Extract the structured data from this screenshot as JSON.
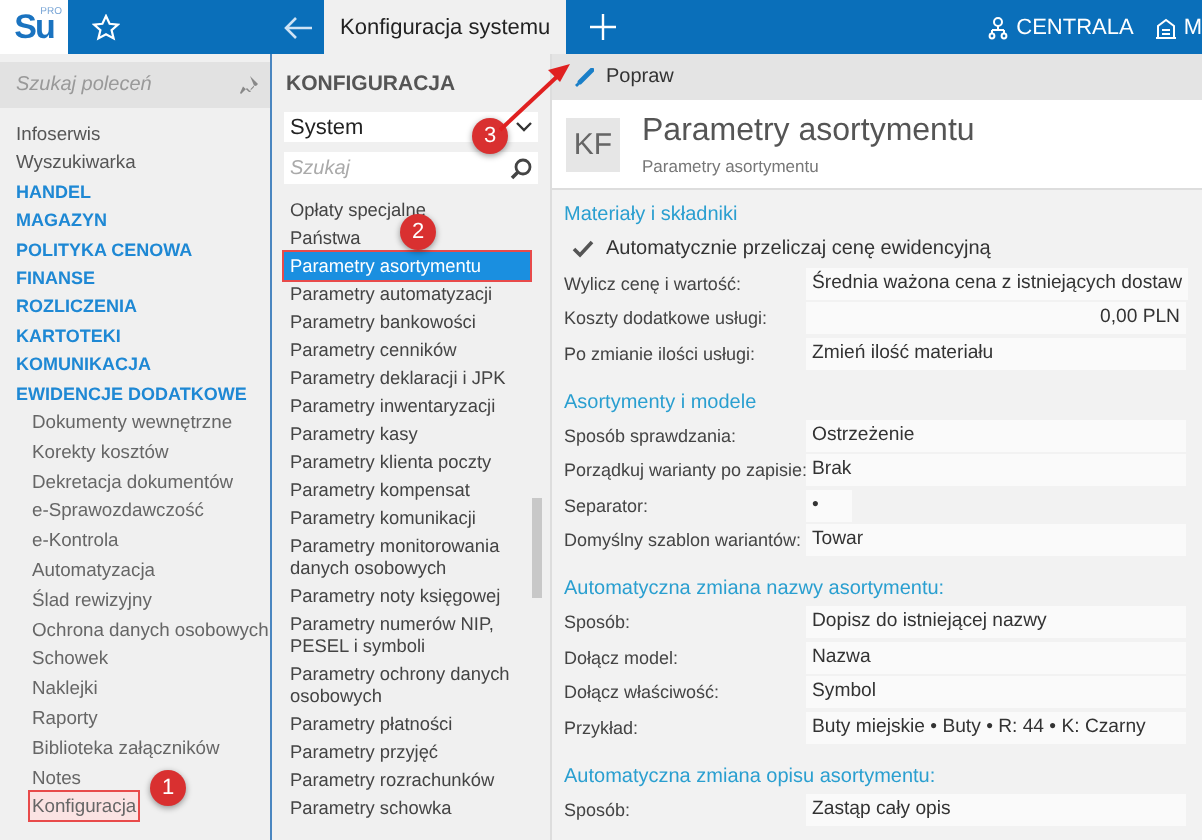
{
  "top_bar": {
    "logo": "Su",
    "logo_badge": "PRO",
    "tab": {
      "label": "Konfiguracja systemu",
      "selected": true
    },
    "location": "CENTRALA",
    "store": "M"
  },
  "sidebar": {
    "search_placeholder": "Szukaj poleceń",
    "items": [
      {
        "label": "Infoserwis",
        "kind": "link"
      },
      {
        "label": "Wyszukiwarka",
        "kind": "link"
      },
      {
        "label": "HANDEL",
        "kind": "category"
      },
      {
        "label": "MAGAZYN",
        "kind": "category"
      },
      {
        "label": "POLITYKA CENOWA",
        "kind": "category"
      },
      {
        "label": "FINANSE",
        "kind": "category"
      },
      {
        "label": "ROZLICZENIA",
        "kind": "category"
      },
      {
        "label": "KARTOTEKI",
        "kind": "category"
      },
      {
        "label": "KOMUNIKACJA",
        "kind": "category"
      },
      {
        "label": "EWIDENCJE DODATKOWE",
        "kind": "category",
        "children": [
          {
            "label": "Dokumenty wewnętrzne",
            "highlighted": false
          },
          {
            "label": "Korekty kosztów",
            "highlighted": false
          },
          {
            "label": "Dekretacja dokumentów",
            "highlighted": false
          },
          {
            "label": "e-Sprawozdawczość",
            "highlighted": false
          },
          {
            "label": "e-Kontrola",
            "highlighted": false
          },
          {
            "label": "Automatyzacja",
            "highlighted": false
          },
          {
            "label": "Ślad rewizyjny",
            "highlighted": false
          },
          {
            "label": "Ochrona danych osobowych",
            "highlighted": false
          },
          {
            "label": "Schowek",
            "highlighted": false
          },
          {
            "label": "Naklejki",
            "highlighted": false
          },
          {
            "label": "Raporty",
            "highlighted": false
          },
          {
            "label": "Biblioteka załączników",
            "highlighted": false
          },
          {
            "label": "Notes",
            "highlighted": false
          },
          {
            "label": "Konfiguracja",
            "highlighted": true
          }
        ]
      }
    ]
  },
  "middle": {
    "heading": "KONFIGURACJA",
    "module": "System",
    "search_placeholder": "Szukaj",
    "items": [
      {
        "label": "Opłaty specjalne",
        "selected": false
      },
      {
        "label": "Państwa",
        "selected": false
      },
      {
        "label": "Parametry asortymentu",
        "selected": true
      },
      {
        "label": "Parametry automatyzacji",
        "selected": false
      },
      {
        "label": "Parametry bankowości",
        "selected": false
      },
      {
        "label": "Parametry cenników",
        "selected": false
      },
      {
        "label": "Parametry deklaracji i JPK",
        "selected": false
      },
      {
        "label": "Parametry inwentaryzacji",
        "selected": false
      },
      {
        "label": "Parametry kasy",
        "selected": false
      },
      {
        "label": "Parametry klienta poczty",
        "selected": false
      },
      {
        "label": "Parametry kompensat",
        "selected": false
      },
      {
        "label": "Parametry komunikacji",
        "selected": false
      },
      {
        "label": "Parametry monitorowania danych osobowych",
        "selected": false
      },
      {
        "label": "Parametry noty księgowej",
        "selected": false
      },
      {
        "label": "Parametry numerów NIP, PESEL i symboli",
        "selected": false
      },
      {
        "label": "Parametry ochrony danych osobowych",
        "selected": false
      },
      {
        "label": "Parametry płatności",
        "selected": false
      },
      {
        "label": "Parametry przyjęć",
        "selected": false
      },
      {
        "label": "Parametry rozrachunków",
        "selected": false
      },
      {
        "label": "Parametry schowka",
        "selected": false
      }
    ]
  },
  "content": {
    "edit_button": "Popraw",
    "header": {
      "badge": "KF",
      "title": "Parametry asortymentu",
      "subtitle": "Parametry asortymentu"
    },
    "sections": [
      {
        "title": "Materiały i składniki",
        "rows": [
          {
            "kind": "checkbox",
            "label": "Automatycznie przeliczaj cenę ewidencyjną",
            "checked": true
          },
          {
            "kind": "text",
            "label": "Wylicz cenę i wartość:",
            "value": "Średnia ważona cena z istniejących dostaw"
          },
          {
            "kind": "amount",
            "label": "Koszty dodatkowe usługi:",
            "value": "0,00 PLN"
          },
          {
            "kind": "text",
            "label": "Po zmianie ilości usługi:",
            "value": "Zmień ilość materiału"
          }
        ]
      },
      {
        "title": "Asortymenty i modele",
        "rows": [
          {
            "kind": "text",
            "label": "Sposób sprawdzania:",
            "value": "Ostrzeżenie"
          },
          {
            "kind": "text",
            "label": "Porządkuj warianty po zapisie:",
            "value": "Brak"
          },
          {
            "kind": "short",
            "label": "Separator:",
            "value": "•"
          },
          {
            "kind": "text",
            "label": "Domyślny szablon wariantów:",
            "value": "Towar"
          }
        ]
      },
      {
        "title": "Automatyczna zmiana nazwy asortymentu:",
        "rows": [
          {
            "kind": "text",
            "label": "Sposób:",
            "value": "Dopisz do istniejącej nazwy"
          },
          {
            "kind": "text",
            "label": "Dołącz model:",
            "value": "Nazwa"
          },
          {
            "kind": "text",
            "label": "Dołącz właściwość:",
            "value": "Symbol"
          },
          {
            "kind": "text",
            "label": "Przykład:",
            "value": "Buty miejskie • Buty • R: 44 • K: Czarny"
          }
        ]
      },
      {
        "title": "Automatyczna zmiana opisu asortymentu:",
        "rows": [
          {
            "kind": "text",
            "label": "Sposób:",
            "value": "Zastąp cały opis"
          }
        ]
      }
    ]
  },
  "callouts": [
    "1",
    "2",
    "3"
  ]
}
